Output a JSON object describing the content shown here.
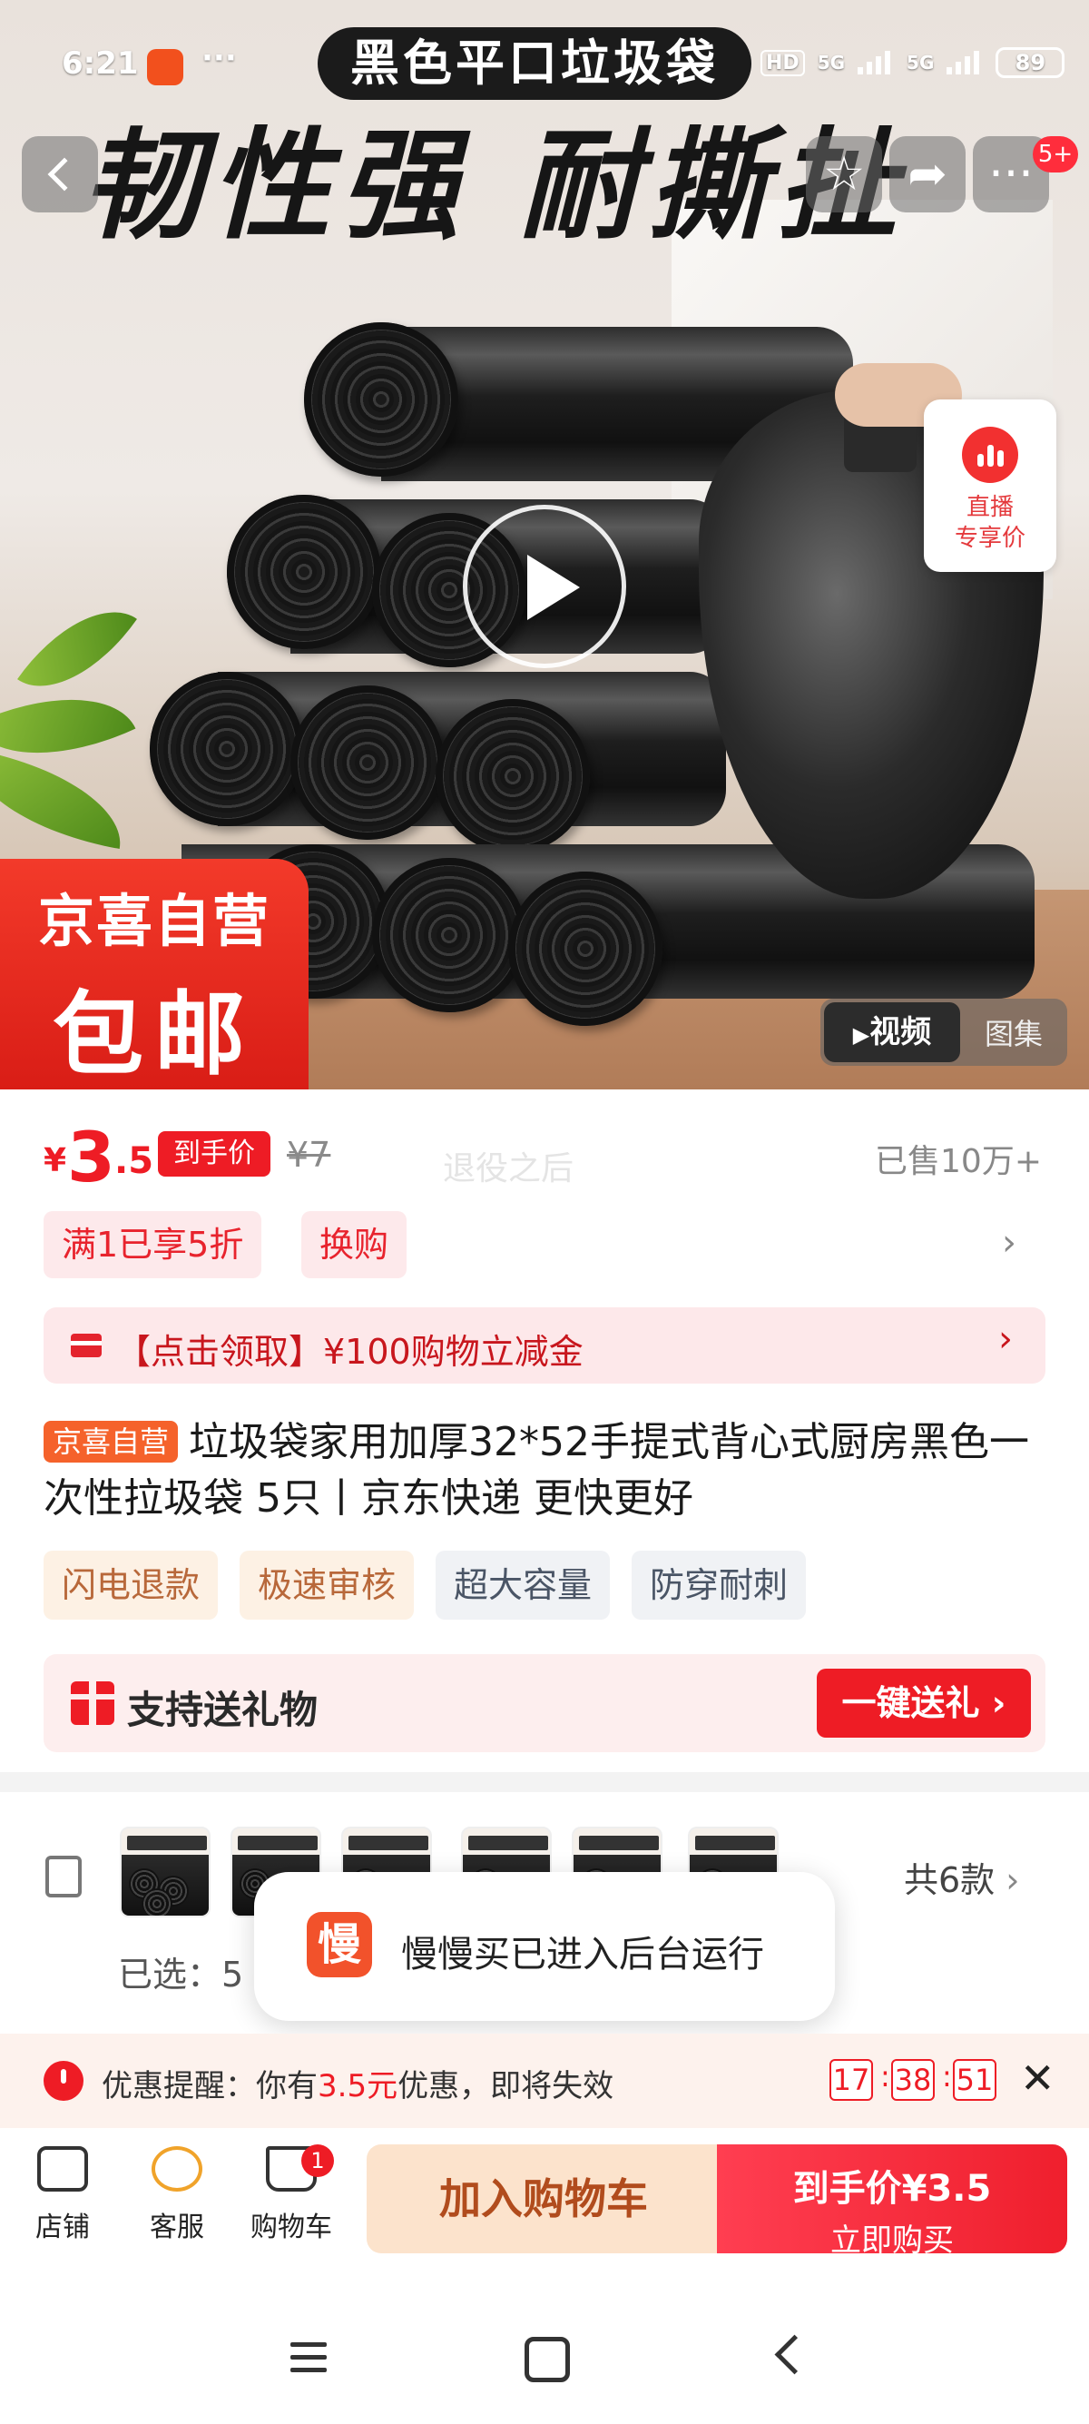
{
  "status_bar": {
    "time": "6:21",
    "dots": "···",
    "hd": "HD",
    "net1": "5G",
    "net2": "5G",
    "battery": "89"
  },
  "hero": {
    "banner_title": "黑色平口垃圾袋",
    "slogan": "韧性强 耐撕扯",
    "live_label_1": "直播",
    "live_label_2": "专享价",
    "badge_line1": "京喜自营",
    "badge_line2": "包邮",
    "media_video": "视频",
    "media_gallery": "图集",
    "nav_badge": "5+"
  },
  "price": {
    "symbol": "¥",
    "integer": "3",
    "decimal": ".5",
    "tag": "到手价",
    "original": "¥7",
    "watermark": "退役之后",
    "sold": "已售10万+"
  },
  "promos": {
    "chip1": "满1已享5折",
    "chip2": "换购"
  },
  "coupon": {
    "text": "【点击领取】¥100购物立减金"
  },
  "title": {
    "tag": "京喜自营",
    "text": "垃圾袋家用加厚32*52手提式背心式厨房黑色一次性拉圾袋 5只丨京东快递 更快更好"
  },
  "features": [
    "闪电退款",
    "极速审核",
    "超大容量",
    "防穿耐刺"
  ],
  "gift": {
    "text": "支持送礼物",
    "button": "一键送礼"
  },
  "variants": {
    "count_label": "共6款",
    "selected_label": "已选：5",
    "thumb_count": 6
  },
  "toast": {
    "icon_char": "慢",
    "text": "慢慢买已进入后台运行"
  },
  "reminder": {
    "prefix": "优惠提醒：你有",
    "amount": "3.5元",
    "suffix": "优惠，即将失效",
    "hh": "17",
    "mm": "38",
    "ss": "51"
  },
  "bottom_bar": {
    "store": "店铺",
    "service": "客服",
    "cart": "购物车",
    "cart_badge": "1",
    "add_to_cart": "加入购物车",
    "buy_price": "到手价¥3.5",
    "buy_now": "立即购买"
  }
}
